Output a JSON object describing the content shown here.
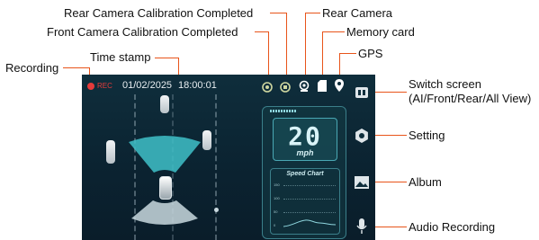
{
  "callouts": {
    "recording": "Recording",
    "time_stamp": "Time stamp",
    "rear_cal": "Rear Camera Calibration Completed",
    "front_cal": "Front Camera Calibration Completed",
    "rear_camera": "Rear Camera",
    "memory_card": "Memory card",
    "gps": "GPS",
    "switch_screen_1": "Switch screen",
    "switch_screen_2": "(AI/Front/Rear/All View)",
    "setting": "Setting",
    "album": "Album",
    "audio_recording": "Audio Recording"
  },
  "status": {
    "rec": "REC",
    "date": "01/02/2025",
    "time": "18:00:01"
  },
  "speed": {
    "value": "20",
    "unit": "mph",
    "chart_title": "Speed Chart",
    "y_ticks": [
      "150",
      "100",
      "50",
      "0"
    ]
  },
  "colors": {
    "accent": "#e8541a",
    "rec_red": "#e53b3b",
    "screen_bg": "#0f2e3c",
    "radar_teal": "#3fc1c9"
  },
  "icons": {
    "front_cal": "front-calibration-icon",
    "rear_cal": "rear-calibration-icon",
    "rear_camera": "rear-camera-icon",
    "memory_card": "memory-card-icon",
    "gps": "gps-pin-icon",
    "switch_screen": "switch-screen-icon",
    "setting": "gear-icon",
    "album": "album-icon",
    "audio": "microphone-icon"
  }
}
